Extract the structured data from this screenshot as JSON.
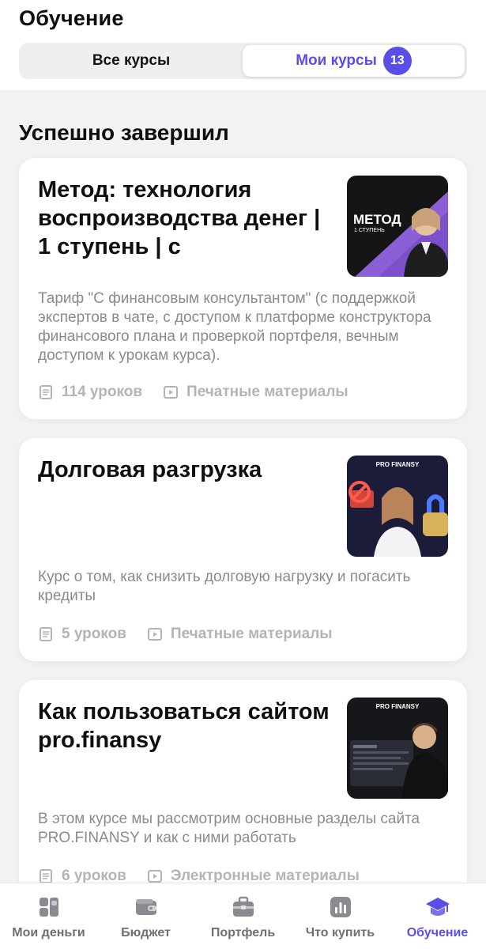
{
  "header": {
    "title": "Обучение"
  },
  "segments": {
    "all_label": "Все курсы",
    "mine_label": "Мои курсы",
    "mine_count": "13"
  },
  "section_title": "Успешно завершил",
  "courses": [
    {
      "title": "Метод: технология воспроизводства денег | 1 ступень | с",
      "description": "Тариф \"С финансовым консультантом\" (с поддержкой экспертов в чате, с доступом к платформе конструктора финансового плана и проверкой портфеля, вечным доступом к урокам курса).",
      "lessons": "114 уроков",
      "materials": "Печатные материалы",
      "thumb_caption_main": "МЕТОД",
      "thumb_caption_sub": "1 СТУПЕНЬ"
    },
    {
      "title": "Долговая разгрузка",
      "description": "Курс о том, как снизить долговую нагрузку и погасить кредиты",
      "lessons": "5 уроков",
      "materials": "Печатные материалы",
      "thumb_brand": "PRO FINANSY"
    },
    {
      "title": "Как пользоваться сайтом pro.finansy",
      "description": "В этом курсе мы рассмотрим основные разделы сайта PRO.FINANSY и как с ними работать",
      "lessons": "6 уроков",
      "materials": "Электронные материалы",
      "thumb_brand": "PRO FINANSY"
    }
  ],
  "tabbar": {
    "items": [
      {
        "label": "Мои деньги",
        "icon": "wallet-grid-icon"
      },
      {
        "label": "Бюджет",
        "icon": "wallet-icon"
      },
      {
        "label": "Портфель",
        "icon": "briefcase-icon"
      },
      {
        "label": "Что купить",
        "icon": "chart-icon"
      },
      {
        "label": "Обучение",
        "icon": "graduation-cap-icon"
      }
    ],
    "active_index": 4
  },
  "colors": {
    "accent": "#5b4ee8",
    "muted": "#8a8a90",
    "meta": "#b3b3b8"
  }
}
